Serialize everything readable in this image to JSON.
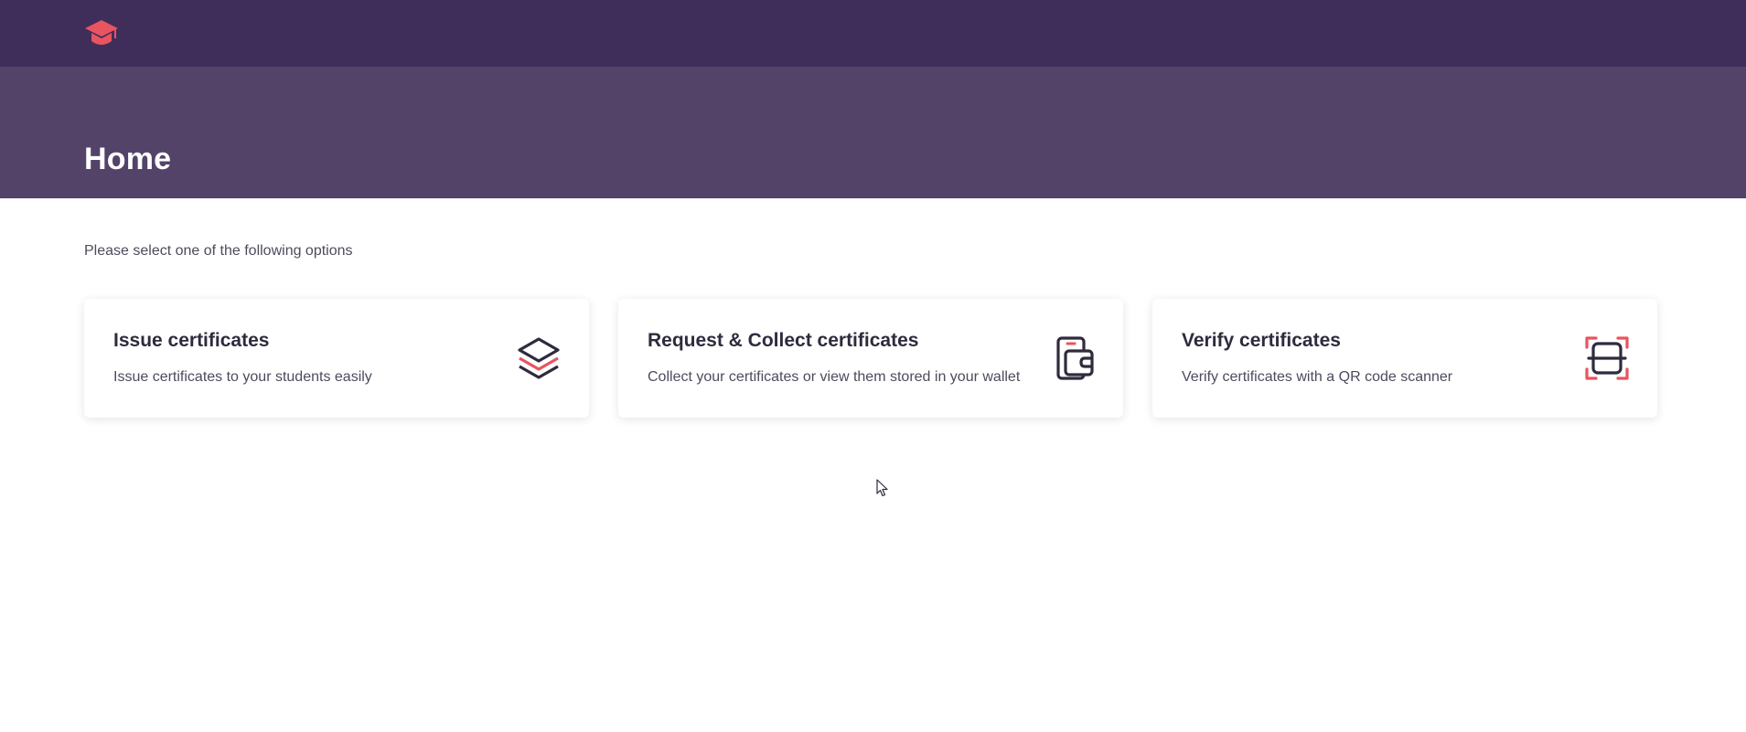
{
  "header": {
    "logo_icon": "graduation-cap-icon",
    "brand_color": "#e8545f",
    "background": "#3f2d5a"
  },
  "hero": {
    "title": "Home",
    "background": "#534368"
  },
  "main": {
    "subtitle": "Please select one of the following options",
    "cards": [
      {
        "title": "Issue certificates",
        "description": "Issue certificates to your students easily",
        "icon": "stacked-layers-icon"
      },
      {
        "title": "Request & Collect certificates",
        "description": "Collect your certificates or view them stored in your wallet",
        "icon": "wallet-phone-icon"
      },
      {
        "title": "Verify certificates",
        "description": "Verify certificates with a QR code scanner",
        "icon": "qr-scanner-icon"
      }
    ]
  },
  "colors": {
    "accent": "#e8545f",
    "icon_dark": "#2f2b3d"
  }
}
